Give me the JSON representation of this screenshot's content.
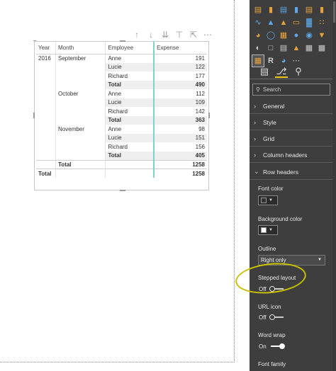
{
  "toolbar": {
    "icons": [
      "arrow-up-icon",
      "arrow-down-icon",
      "double-arrow-down-icon",
      "expand-down-icon",
      "focus-mode-icon",
      "more-options-icon"
    ]
  },
  "table": {
    "headers": {
      "year": "Year",
      "month": "Month",
      "employee": "Employee",
      "expense": "Expense"
    },
    "rows": [
      {
        "year": "2016",
        "month": "September",
        "employee": "Anne",
        "expense": "191",
        "bold": false
      },
      {
        "year": "",
        "month": "",
        "employee": "Lucie",
        "expense": "122",
        "bold": false
      },
      {
        "year": "",
        "month": "",
        "employee": "Richard",
        "expense": "177",
        "bold": false
      },
      {
        "year": "",
        "month": "",
        "employee": "Total",
        "expense": "490",
        "bold": true
      },
      {
        "year": "",
        "month": "October",
        "employee": "Anne",
        "expense": "112",
        "bold": false
      },
      {
        "year": "",
        "month": "",
        "employee": "Lucie",
        "expense": "109",
        "bold": false
      },
      {
        "year": "",
        "month": "",
        "employee": "Richard",
        "expense": "142",
        "bold": false
      },
      {
        "year": "",
        "month": "",
        "employee": "Total",
        "expense": "363",
        "bold": true
      },
      {
        "year": "",
        "month": "November",
        "employee": "Anne",
        "expense": "98",
        "bold": false
      },
      {
        "year": "",
        "month": "",
        "employee": "Lucie",
        "expense": "151",
        "bold": false
      },
      {
        "year": "",
        "month": "",
        "employee": "Richard",
        "expense": "156",
        "bold": false
      },
      {
        "year": "",
        "month": "",
        "employee": "Total",
        "expense": "405",
        "bold": true
      },
      {
        "year": "",
        "month": "Total",
        "employee": "",
        "expense": "1258",
        "bold": true
      },
      {
        "year": "Total",
        "month": "",
        "employee": "",
        "expense": "1258",
        "bold": true
      }
    ]
  },
  "pane": {
    "search_placeholder": "Search",
    "sections": [
      "General",
      "Style",
      "Grid",
      "Column headers",
      "Row headers"
    ],
    "font_color_label": "Font color",
    "font_color_value": "#333333",
    "background_color_label": "Background color",
    "background_color_value": "#ffffff",
    "outline_label": "Outline",
    "outline_value": "Right only",
    "stepped_layout_label": "Stepped layout",
    "stepped_layout_state": "Off",
    "url_icon_label": "URL icon",
    "url_icon_state": "Off",
    "word_wrap_label": "Word wrap",
    "word_wrap_state": "On",
    "font_family_label": "Font family"
  },
  "colors": {
    "pane_bg": "#3e3e3e",
    "accent_yellow": "#f2c811",
    "expense_divider": "#7fd3cf",
    "annotation_circle": "#c8c000"
  }
}
